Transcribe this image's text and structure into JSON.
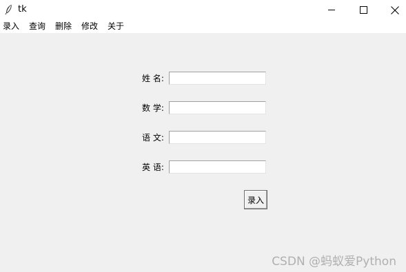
{
  "window": {
    "title": "tk"
  },
  "menu": {
    "items": [
      "录入",
      "查询",
      "删除",
      "修改",
      "关于"
    ]
  },
  "form": {
    "fields": [
      {
        "label": "姓 名:",
        "value": ""
      },
      {
        "label": "数 学:",
        "value": ""
      },
      {
        "label": "语 文:",
        "value": ""
      },
      {
        "label": "英 语:",
        "value": ""
      }
    ],
    "submit_label": "录入"
  },
  "watermark": "CSDN @蚂蚁爱Python",
  "icons": {
    "app": "feather-icon",
    "minimize": "minimize-icon",
    "maximize": "maximize-icon",
    "close": "close-icon"
  },
  "colors": {
    "window_bg": "#f0f0f0",
    "titlebar_bg": "#ffffff",
    "entry_bg": "#ffffff",
    "watermark": "#b0b0b0"
  }
}
